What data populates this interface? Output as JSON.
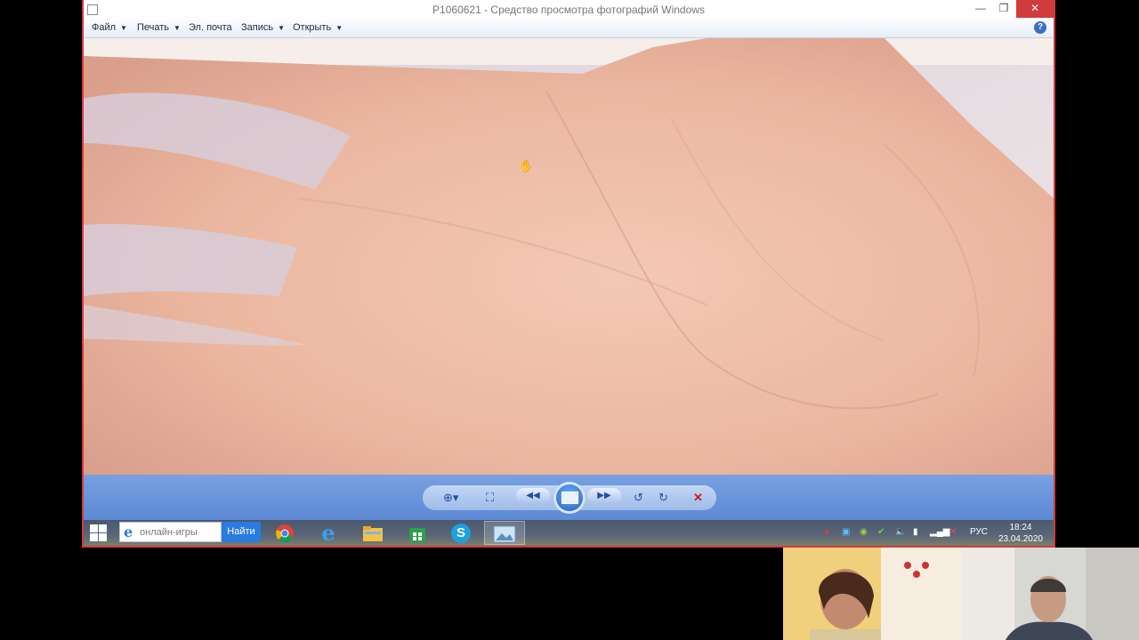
{
  "window": {
    "title": "P1060621 - Средство просмотра фотографий Windows",
    "minimize": "—",
    "maximize": "❐",
    "close": "✕"
  },
  "menu": {
    "items": [
      {
        "label": "Файл",
        "has_arrow": true
      },
      {
        "label": "Печать",
        "has_arrow": true
      },
      {
        "label": "Эл. почта",
        "has_arrow": false
      },
      {
        "label": "Запись",
        "has_arrow": true
      },
      {
        "label": "Открыть",
        "has_arrow": true
      }
    ],
    "help": "?"
  },
  "controls": {
    "zoom": "magnifier-icon",
    "actual_size": "fit-window-icon",
    "previous": "previous-icon",
    "slideshow": "slideshow-icon",
    "next": "next-icon",
    "rotate_ccw": "rotate-left-icon",
    "rotate_cw": "rotate-right-icon",
    "delete": "✕"
  },
  "taskbar": {
    "search_placeholder": "онлайн-игры",
    "search_button": "Найти",
    "apps": [
      "chrome-icon",
      "ie-icon",
      "file-explorer-icon",
      "store-icon",
      "skype-icon",
      "photo-viewer-icon"
    ],
    "language": "РУС",
    "time": "18:24",
    "date": "23.04.2020"
  },
  "colors": {
    "accent": "#5d89d5",
    "window_border": "#d23b3b",
    "skin": "#eab49f"
  }
}
